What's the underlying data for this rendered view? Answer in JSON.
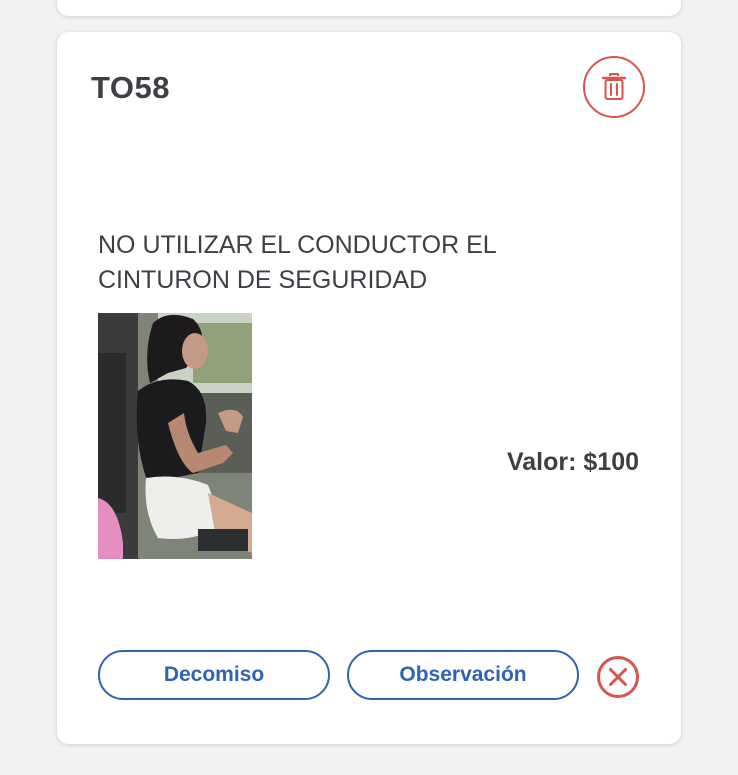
{
  "record": {
    "code": "TO58",
    "description": "NO UTILIZAR EL CONDUCTOR EL CINTURON DE SEGURIDAD",
    "value_text": "Valor: $100"
  },
  "actions": {
    "decomiso_label": "Decomiso",
    "observacion_label": "Observación"
  },
  "icons": {
    "delete": "trash-icon",
    "remove": "close-circle-icon"
  },
  "colors": {
    "danger": "#d9534f",
    "primary": "#2f63b3",
    "text": "#3c3f44"
  }
}
